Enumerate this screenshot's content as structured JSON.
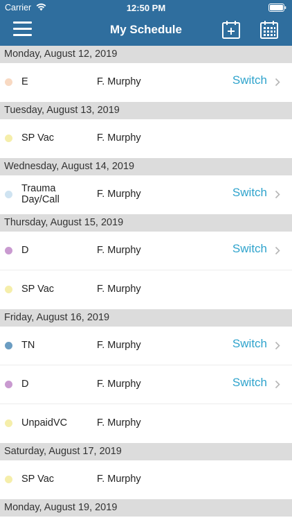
{
  "status_bar": {
    "carrier": "Carrier",
    "time": "12:50 PM"
  },
  "nav": {
    "title": "My Schedule",
    "menu_icon": "hamburger-menu-icon",
    "add_icon": "calendar-add-icon",
    "calendar_icon": "calendar-icon"
  },
  "colors": {
    "header": "#2f6e9e",
    "switch": "#2ea3cc",
    "section_bg": "#dcdcdc"
  },
  "schedule": [
    {
      "date": "Monday, August 12, 2019",
      "shifts": [
        {
          "name": "E",
          "person": "F. Murphy",
          "action": "Switch",
          "color": "#f8d9c2"
        }
      ]
    },
    {
      "date": "Tuesday, August 13, 2019",
      "shifts": [
        {
          "name": "SP Vac",
          "person": "F. Murphy",
          "action": "",
          "color": "#f5eeaa"
        }
      ]
    },
    {
      "date": "Wednesday, August 14, 2019",
      "shifts": [
        {
          "name": "Trauma Day/Call",
          "person": "F. Murphy",
          "action": "Switch",
          "color": "#cfe3f1"
        }
      ]
    },
    {
      "date": "Thursday, August 15, 2019",
      "shifts": [
        {
          "name": "D",
          "person": "F. Murphy",
          "action": "Switch",
          "color": "#c99ad0"
        },
        {
          "name": "SP Vac",
          "person": "F. Murphy",
          "action": "",
          "color": "#f5eeaa"
        }
      ]
    },
    {
      "date": "Friday, August 16, 2019",
      "shifts": [
        {
          "name": "TN",
          "person": "F. Murphy",
          "action": "Switch",
          "color": "#6b9dc2"
        },
        {
          "name": "D",
          "person": "F. Murphy",
          "action": "Switch",
          "color": "#c99ad0"
        },
        {
          "name": "UnpaidVC",
          "person": "F. Murphy",
          "action": "",
          "color": "#f5eeaa"
        }
      ]
    },
    {
      "date": "Saturday, August 17, 2019",
      "shifts": [
        {
          "name": "SP Vac",
          "person": "F. Murphy",
          "action": "",
          "color": "#f5eeaa"
        }
      ]
    },
    {
      "date": "Monday, August 19, 2019",
      "shifts": []
    }
  ]
}
